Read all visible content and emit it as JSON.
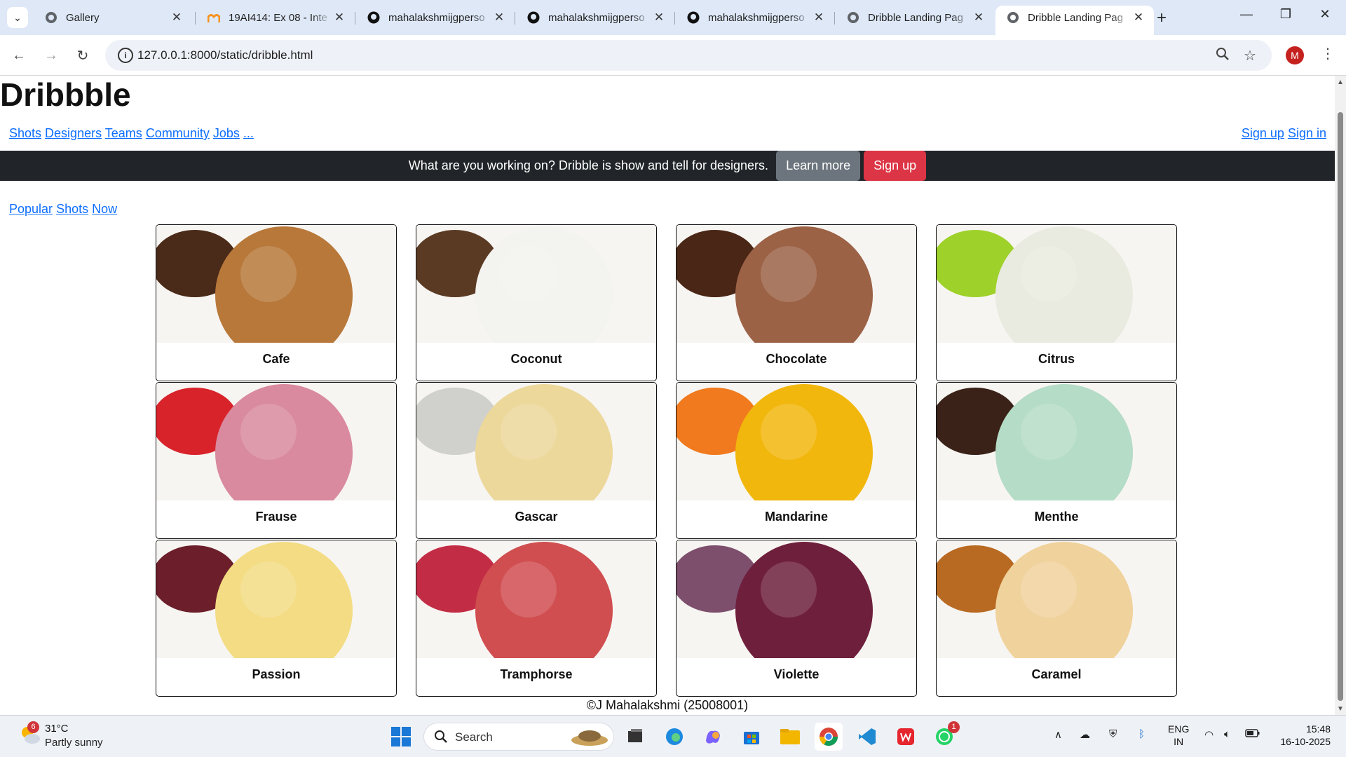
{
  "browser": {
    "tabs": [
      {
        "label": "Gallery",
        "icon": "globe-icon"
      },
      {
        "label": "19AI414: Ex 08 - Inte",
        "icon": "moodle-icon"
      },
      {
        "label": "mahalakshmijgperso",
        "icon": "github-icon"
      },
      {
        "label": "mahalakshmijgperso",
        "icon": "github-icon"
      },
      {
        "label": "mahalakshmijgperso",
        "icon": "github-icon"
      },
      {
        "label": "Dribble Landing Pag",
        "icon": "globe-icon"
      },
      {
        "label": "Dribble Landing Pag",
        "icon": "globe-icon",
        "active": true
      }
    ],
    "url": "127.0.0.1:8000/static/dribble.html",
    "profile_initial": "M",
    "profile_color": "#c5221f"
  },
  "page": {
    "title": "Dribbble",
    "nav_links": [
      "Shots",
      "Designers",
      "Teams",
      "Community",
      "Jobs",
      "..."
    ],
    "auth_links": [
      "Sign up",
      "Sign in"
    ],
    "banner": {
      "text": "What are you working on? Dribble is show and tell for designers.",
      "learn_more": "Learn more",
      "sign_up": "Sign up"
    },
    "filters": [
      "Popular",
      "Shots",
      "Now"
    ],
    "cards": [
      {
        "title": "Cafe",
        "scoop_color": "#b8783a",
        "accent_color": "#4a2a18"
      },
      {
        "title": "Coconut",
        "scoop_color": "#f3f3ef",
        "accent_color": "#5b3a24"
      },
      {
        "title": "Chocolate",
        "scoop_color": "#9c6246",
        "accent_color": "#4a2616"
      },
      {
        "title": "Citrus",
        "scoop_color": "#e9ebe0",
        "accent_color": "#9ed12a"
      },
      {
        "title": "Frause",
        "scoop_color": "#d98a9e",
        "accent_color": "#d8232a"
      },
      {
        "title": "Gascar",
        "scoop_color": "#ecd89a",
        "accent_color": "#d0d0cc"
      },
      {
        "title": "Mandarine",
        "scoop_color": "#f2b70d",
        "accent_color": "#f07a1d"
      },
      {
        "title": "Menthe",
        "scoop_color": "#b5dcc6",
        "accent_color": "#3a2218"
      },
      {
        "title": "Passion",
        "scoop_color": "#f3dc83",
        "accent_color": "#6c1f2a"
      },
      {
        "title": "Tramphorse",
        "scoop_color": "#d04d50",
        "accent_color": "#c22d45"
      },
      {
        "title": "Violette",
        "scoop_color": "#6e1f3c",
        "accent_color": "#7d4f6d"
      },
      {
        "title": "Caramel",
        "scoop_color": "#f0d29c",
        "accent_color": "#b86a23"
      }
    ],
    "footer": "©J Mahalakshmi (25008001)"
  },
  "taskbar": {
    "weather_temp": "31°C",
    "weather_desc": "Partly sunny",
    "weather_badge": "6",
    "search_label": "Search",
    "whatsapp_badge": "1",
    "lang_line1": "ENG",
    "lang_line2": "IN",
    "time": "15:48",
    "date": "16-10-2025"
  }
}
